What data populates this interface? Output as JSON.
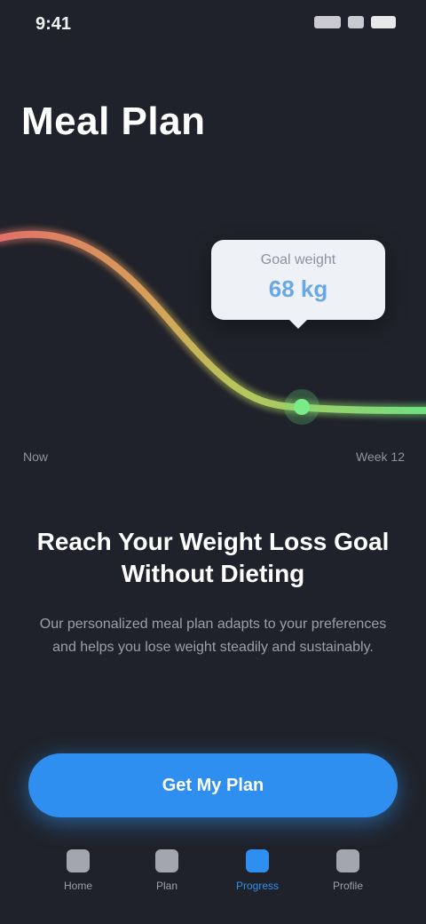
{
  "status_bar": {
    "time": "9:41"
  },
  "header": {
    "title": "Meal Plan"
  },
  "chart": {
    "tooltip_label": "Goal weight",
    "tooltip_value": "68 kg",
    "start_label": "Now",
    "end_label": "Week 12"
  },
  "content": {
    "headline": "Reach Your Weight Loss Goal Without Dieting",
    "body": "Our personalized meal plan adapts to your preferences and helps you lose weight steadily and sustainably."
  },
  "cta": {
    "label": "Get My Plan"
  },
  "tabs": [
    {
      "label": "Home"
    },
    {
      "label": "Plan"
    },
    {
      "label": "Progress"
    },
    {
      "label": "Profile"
    }
  ],
  "colors": {
    "accent": "#2f8ff0",
    "background": "#1f222a",
    "curve_start": "#e2706a",
    "curve_end": "#6fe07f"
  }
}
